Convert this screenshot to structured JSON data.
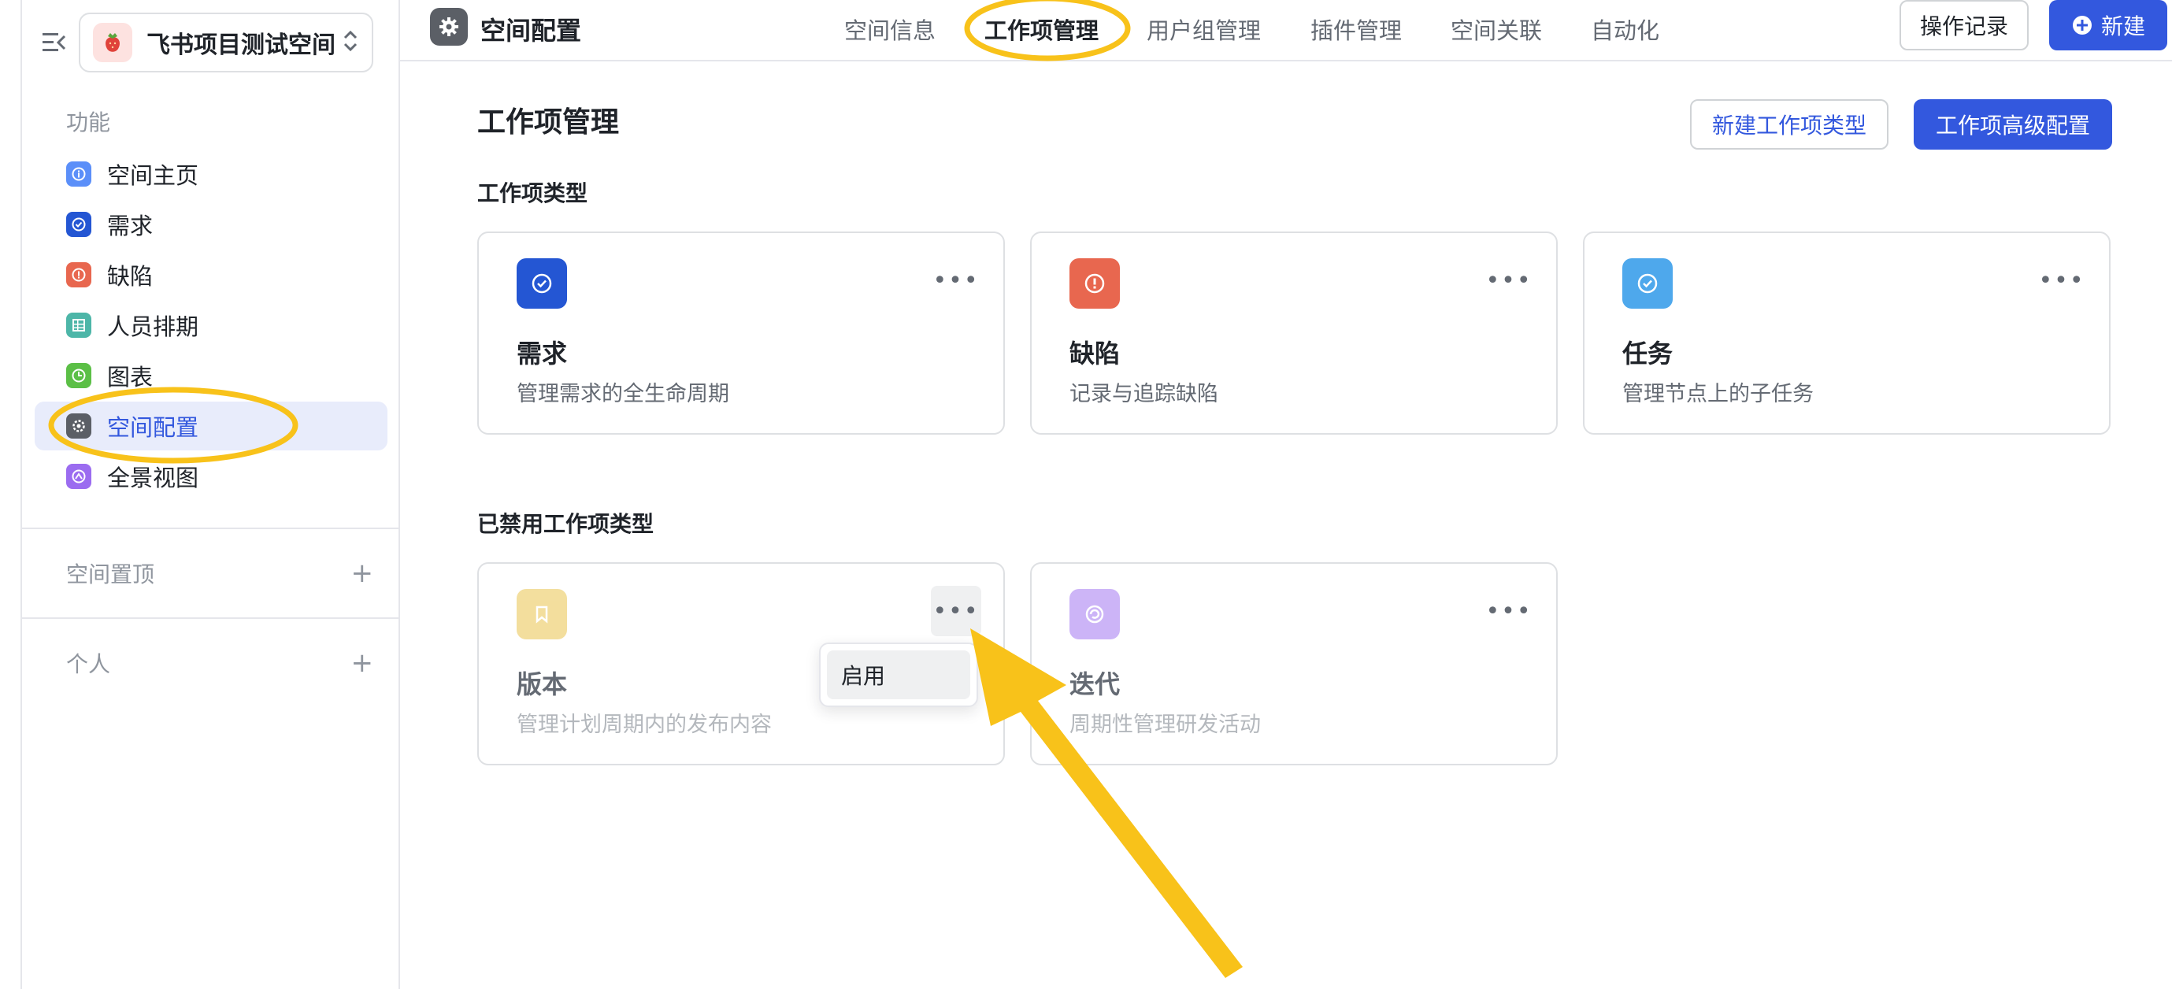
{
  "sidebar": {
    "project_name": "飞书项目测试空间",
    "section_features": "功能",
    "items": [
      {
        "label": "空间主页",
        "icon": "info-icon",
        "color": "#5b8ff9"
      },
      {
        "label": "需求",
        "icon": "check-circle-icon",
        "color": "#2456d3"
      },
      {
        "label": "缺陷",
        "icon": "alert-icon",
        "color": "#e8674f"
      },
      {
        "label": "人员排期",
        "icon": "table-icon",
        "color": "#4db6a8"
      },
      {
        "label": "图表",
        "icon": "clock-chart-icon",
        "color": "#5bbf46"
      },
      {
        "label": "空间配置",
        "icon": "gear-icon",
        "color": "#5b5f66",
        "active": true
      },
      {
        "label": "全景视图",
        "icon": "panorama-icon",
        "color": "#9b6cf0"
      }
    ],
    "section_pinned": "空间置顶",
    "section_personal": "个人"
  },
  "topbar": {
    "title": "空间配置",
    "tabs": [
      "空间信息",
      "工作项管理",
      "用户组管理",
      "插件管理",
      "空间关联",
      "自动化"
    ],
    "active_tab": "工作项管理",
    "log_button": "操作记录",
    "new_button": "新建"
  },
  "main": {
    "title": "工作项管理",
    "new_type_button": "新建工作项类型",
    "advanced_button": "工作项高级配置",
    "enabled_title": "工作项类型",
    "enabled_types": [
      {
        "name": "需求",
        "desc": "管理需求的全生命周期",
        "icon": "check-circle-icon",
        "color": "#2456d3"
      },
      {
        "name": "缺陷",
        "desc": "记录与追踪缺陷",
        "icon": "alert-icon",
        "color": "#e8674f"
      },
      {
        "name": "任务",
        "desc": "管理节点上的子任务",
        "icon": "check-circle-icon",
        "color": "#4ea8ec"
      }
    ],
    "disabled_title": "已禁用工作项类型",
    "disabled_types": [
      {
        "name": "版本",
        "desc": "管理计划周期内的发布内容",
        "icon": "bookmark-icon",
        "color": "#e8bf3d"
      },
      {
        "name": "迭代",
        "desc": "周期性管理研发活动",
        "icon": "cycle-icon",
        "color": "#9b6cf0"
      }
    ],
    "more_glyph": "•••",
    "popup_option": "启用"
  },
  "colors": {
    "accent": "#3358de",
    "annotation": "#f8c21a"
  }
}
